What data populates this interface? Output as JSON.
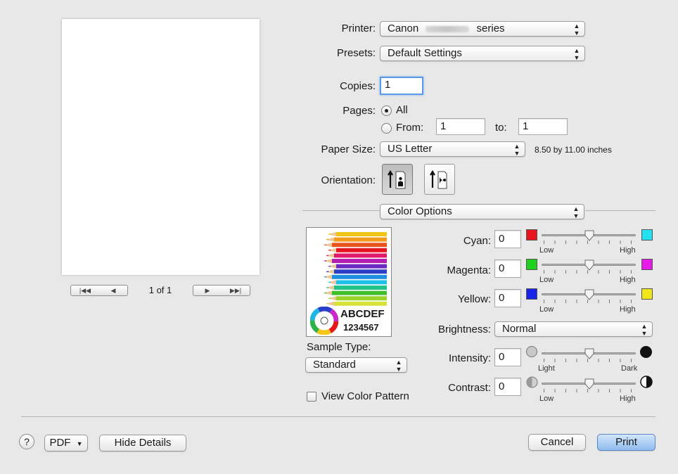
{
  "printer": {
    "label": "Printer:",
    "value_prefix": "Canon",
    "value_suffix": "series"
  },
  "presets": {
    "label": "Presets:",
    "value": "Default Settings"
  },
  "copies": {
    "label": "Copies:",
    "value": "1"
  },
  "pages": {
    "label": "Pages:",
    "all_label": "All",
    "from_label": "From:",
    "from_value": "1",
    "to_label": "to:",
    "to_value": "1",
    "selected": "all"
  },
  "paper_size": {
    "label": "Paper Size:",
    "value": "US Letter",
    "dimensions": "8.50 by 11.00 inches"
  },
  "orientation": {
    "label": "Orientation:",
    "selected": "portrait"
  },
  "section": {
    "value": "Color Options"
  },
  "preview": {
    "page_counter": "1 of 1"
  },
  "sample": {
    "text_letters": "ABCDEF",
    "text_numbers": "1234567",
    "type_label": "Sample Type:",
    "type_value": "Standard"
  },
  "view_color_pattern": {
    "label": "View Color Pattern",
    "checked": false
  },
  "color": {
    "cyan": {
      "label": "Cyan:",
      "value": "0",
      "low": "Low",
      "high": "High"
    },
    "magenta": {
      "label": "Magenta:",
      "value": "0",
      "low": "Low",
      "high": "High"
    },
    "yellow": {
      "label": "Yellow:",
      "value": "0",
      "low": "Low",
      "high": "High"
    },
    "brightness": {
      "label": "Brightness:",
      "value": "Normal"
    },
    "intensity": {
      "label": "Intensity:",
      "value": "0",
      "low": "Light",
      "high": "Dark"
    },
    "contrast": {
      "label": "Contrast:",
      "value": "0",
      "low": "Low",
      "high": "High"
    }
  },
  "footer": {
    "help": "?",
    "pdf": "PDF",
    "hide_details": "Hide Details",
    "cancel": "Cancel",
    "print": "Print"
  },
  "colors": {
    "cyan_low": "#e8141e",
    "cyan_high": "#22e1f0",
    "magenta_low": "#1ed21e",
    "magenta_high": "#e619e6",
    "yellow_low": "#1a23e8",
    "yellow_high": "#f0e619",
    "accent": "#5b9be6"
  }
}
